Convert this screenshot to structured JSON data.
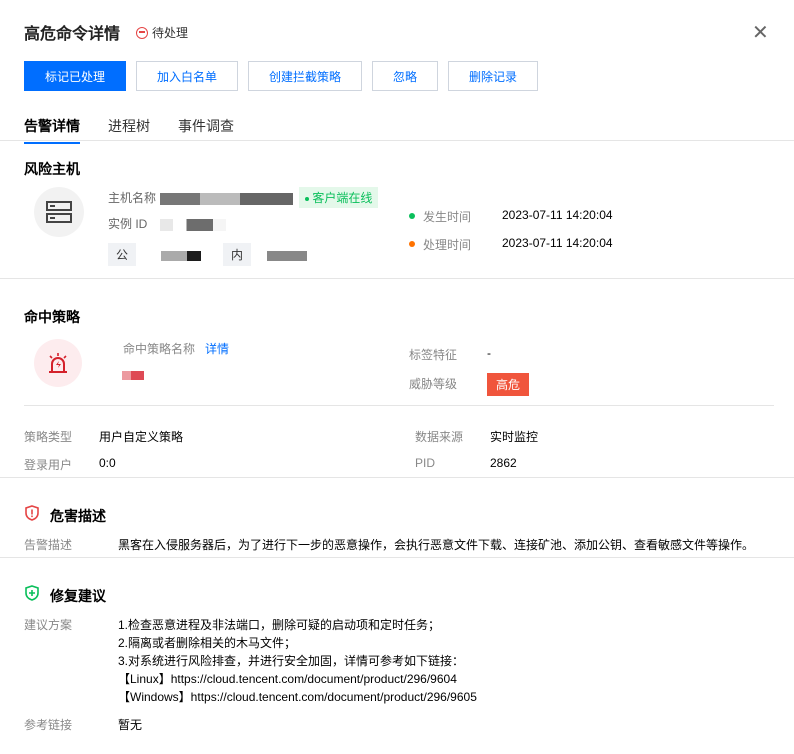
{
  "header": {
    "title": "高危命令详情",
    "status": "待处理"
  },
  "actions": [
    "标记已处理",
    "加入白名单",
    "创建拦截策略",
    "忽略",
    "删除记录"
  ],
  "tabs": [
    "告警详情",
    "进程树",
    "事件调查"
  ],
  "host": {
    "section": "风险主机",
    "name_label": "主机名称",
    "instance_label": "实例 ID",
    "online": "客户端在线",
    "public_tag": "公",
    "private_tag": "内",
    "occur_label": "发生时间",
    "occur_time": "2023-07-11 14:20:04",
    "handle_label": "处理时间",
    "handle_time": "2023-07-11 14:20:04"
  },
  "policy": {
    "section": "命中策略",
    "name_label": "命中策略名称",
    "detail_link": "详情",
    "tag_label": "标签特征",
    "tag_value": "-",
    "level_label": "威胁等级",
    "level_value": "高危",
    "type_label": "策略类型",
    "type_value": "用户自定义策略",
    "source_label": "数据来源",
    "source_value": "实时监控",
    "user_label": "登录用户",
    "user_value": "0:0",
    "pid_label": "PID",
    "pid_value": "2862"
  },
  "harm": {
    "section": "危害描述",
    "label": "告警描述",
    "text": "黑客在入侵服务器后，为了进行下一步的恶意操作，会执行恶意文件下载、连接矿池、添加公钥、查看敏感文件等操作。"
  },
  "fix": {
    "section": "修复建议",
    "label": "建议方案",
    "lines": [
      "1.检查恶意进程及非法端口，删除可疑的启动项和定时任务；",
      "2.隔离或者删除相关的木马文件；",
      "3.对系统进行风险排查，并进行安全加固，详情可参考如下链接：",
      "【Linux】https://cloud.tencent.com/document/product/296/9604",
      "【Windows】https://cloud.tencent.com/document/product/296/9605"
    ],
    "ref_label": "参考链接",
    "ref_value": "暂无"
  },
  "colors": {
    "primary": "#006eff",
    "danger": "#f0553c",
    "success": "#0abf5b"
  }
}
